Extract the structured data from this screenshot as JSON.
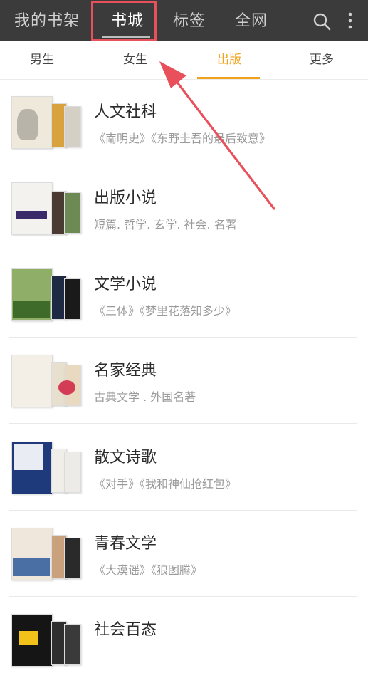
{
  "topbar": {
    "tabs": [
      "我的书架",
      "书城",
      "标签",
      "全网"
    ],
    "active_tab": "书城",
    "icons": [
      "search-icon",
      "more-vert-icon"
    ]
  },
  "subtabs": {
    "items": [
      "男生",
      "女生",
      "出版",
      "更多"
    ],
    "active": "出版"
  },
  "list": [
    {
      "title": "人文社科",
      "subtitle": "《南明史》《东野圭吾的最后致意》"
    },
    {
      "title": "出版小说",
      "subtitle": "短篇. 哲学. 玄学. 社会. 名著"
    },
    {
      "title": "文学小说",
      "subtitle": "《三体》《梦里花落知多少》"
    },
    {
      "title": "名家经典",
      "subtitle": "古典文学 . 外国名著"
    },
    {
      "title": "散文诗歌",
      "subtitle": "《对手》《我和神仙抢红包》"
    },
    {
      "title": "青春文学",
      "subtitle": "《大漠谣》《狼图腾》"
    },
    {
      "title": "社会百态",
      "subtitle": ""
    }
  ],
  "colors": {
    "topbar_bg": "#3b3b3b",
    "accent": "#f0a21c",
    "annotation_red": "#e8505b"
  }
}
